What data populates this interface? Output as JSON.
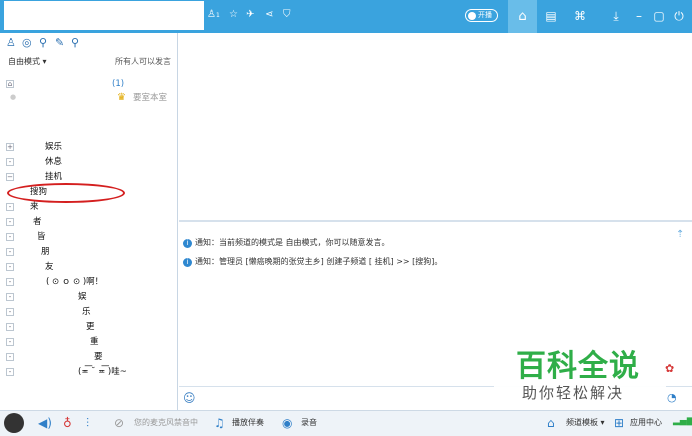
{
  "titlebar": {
    "icons": [
      "user-count-icon",
      "star-icon",
      "plane-icon",
      "share-icon",
      "shield-icon"
    ],
    "user_count": "1",
    "toggle_label": "开播",
    "home_glyph": "⌂",
    "buttons": [
      "window-list-icon",
      "gamepad-icon",
      "download-icon",
      "minimize-icon",
      "maximize-icon",
      "power-icon"
    ]
  },
  "left": {
    "mode_label": "自由模式",
    "speak_permission": "所有人可以发言",
    "channel_count": "(1)",
    "user_name": "要室本室",
    "tree": [
      {
        "text": "",
        "level": 0,
        "box": "⌂"
      },
      {
        "text": "娱乐",
        "level": 1,
        "box": "+"
      },
      {
        "text": "休息",
        "level": 1,
        "box": "-"
      },
      {
        "text": "挂机",
        "level": 1,
        "box": "−"
      },
      {
        "text": "搜狗",
        "level": 0,
        "box": ""
      },
      {
        "text": "来",
        "level": 0,
        "box": "-"
      },
      {
        "text": "者",
        "level": 0,
        "box": "-"
      },
      {
        "text": "皆",
        "level": 0,
        "box": "-"
      },
      {
        "text": "朋",
        "level": 0,
        "box": "-"
      },
      {
        "text": "友",
        "level": 0,
        "box": "-"
      },
      {
        "text": "( ⊙ ｏ ⊙ )啊！",
        "level": 0,
        "box": "-"
      },
      {
        "text": "娱",
        "level": 0,
        "box": "-"
      },
      {
        "text": "乐",
        "level": 0,
        "box": "-"
      },
      {
        "text": "更",
        "level": 0,
        "box": "-"
      },
      {
        "text": "重",
        "level": 0,
        "box": "-"
      },
      {
        "text": "要",
        "level": 0,
        "box": "-"
      },
      {
        "text": "(≖͞ ˘ ≖͞ )哇~",
        "level": 0,
        "box": "-"
      }
    ]
  },
  "notices": [
    "通知：当前频道的模式是 自由模式，你可以随意发言。",
    "通知：管理员 [懒癌晚期的张觉主乡] 创建子频道 [       挂机] >> [搜狗]。"
  ],
  "bottombar": {
    "mic_status": "您的麦克风禁音中",
    "accompany": "播放伴奏",
    "record": "录音",
    "channel_template": "频道模板",
    "app_center": "应用中心"
  },
  "watermark": {
    "title": "百科全说",
    "subtitle": "助你轻松解决"
  },
  "colors": {
    "titlebar": "#3aa3de",
    "accent": "#2f7fc8",
    "highlight_ellipse": "#d41f1f",
    "watermark_green": "#2fae48"
  }
}
